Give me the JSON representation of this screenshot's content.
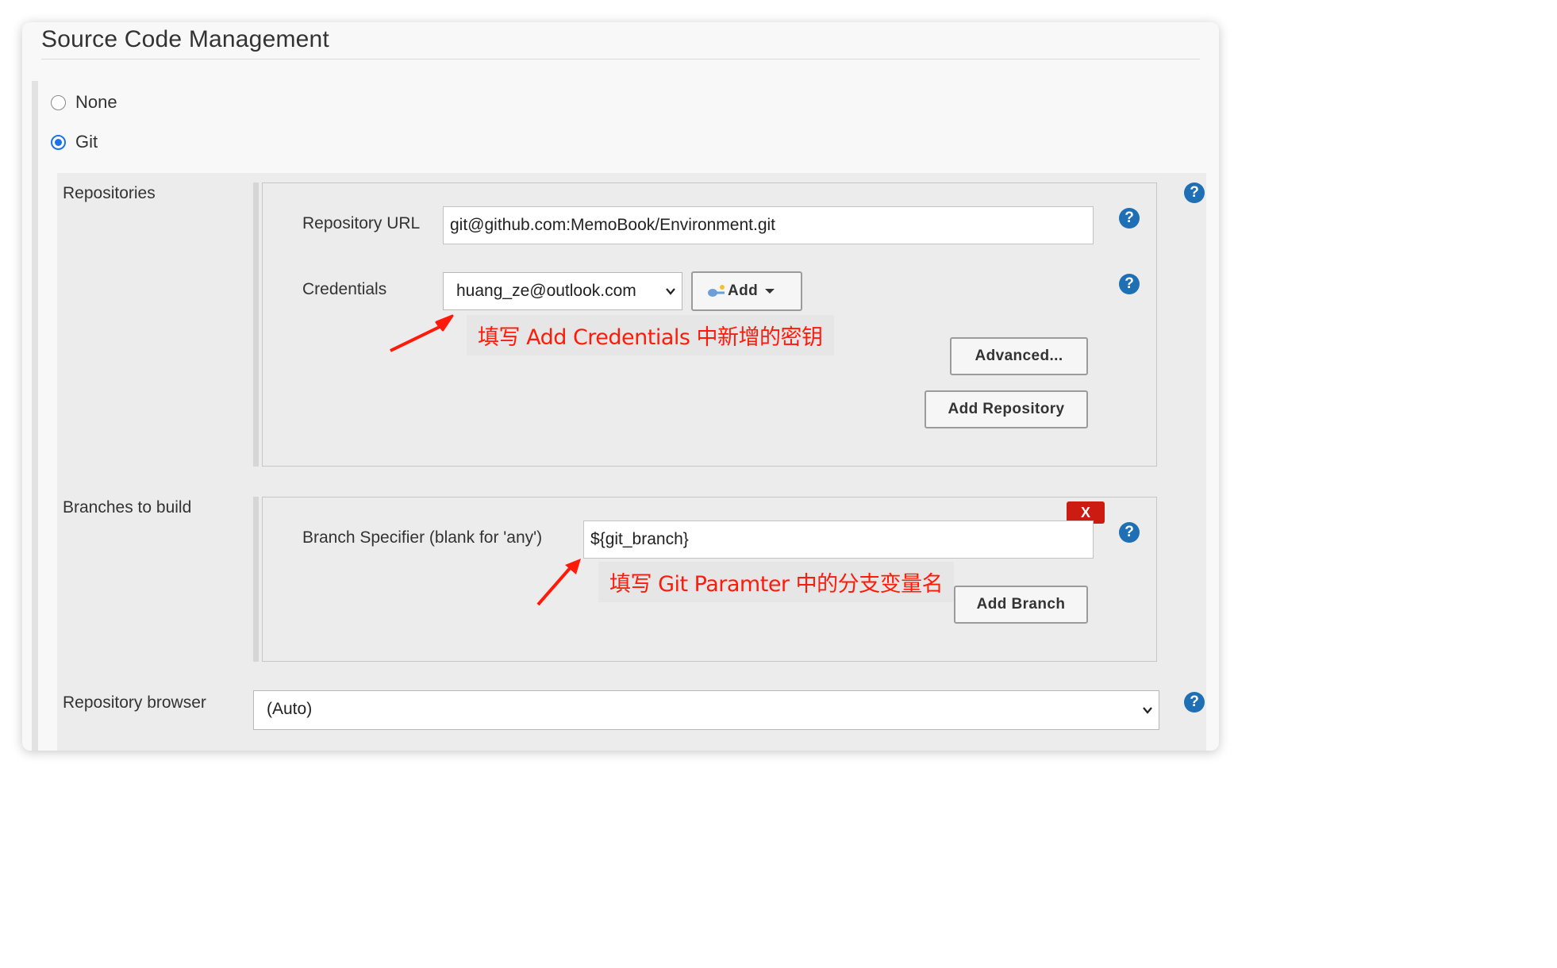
{
  "section": {
    "title": "Source Code Management"
  },
  "scm_options": [
    {
      "label": "None",
      "checked": false
    },
    {
      "label": "Git",
      "checked": true
    }
  ],
  "repositories": {
    "label": "Repositories",
    "url_label": "Repository URL",
    "url_value": "git@github.com:MemoBook/Environment.git",
    "credentials_label": "Credentials",
    "credentials_value": "huang_ze@outlook.com",
    "add_label": "Add",
    "advanced_label": "Advanced...",
    "add_repository_label": "Add Repository",
    "annotation": "填写 Add Credentials 中新增的密钥"
  },
  "branches": {
    "label": "Branches to build",
    "specifier_label": "Branch Specifier (blank for 'any')",
    "specifier_value": "${git_branch}",
    "delete_label": "X",
    "add_branch_label": "Add Branch",
    "annotation": "填写 Git  Paramter 中的分支变量名"
  },
  "browser": {
    "label": "Repository browser",
    "value": "(Auto)"
  },
  "help_icon_text": "?",
  "colors": {
    "annotation": "#ff1a0a",
    "help_icon": "#1f6fb5",
    "delete_button": "#cc1b10",
    "radio_checked": "#1a73e8"
  }
}
